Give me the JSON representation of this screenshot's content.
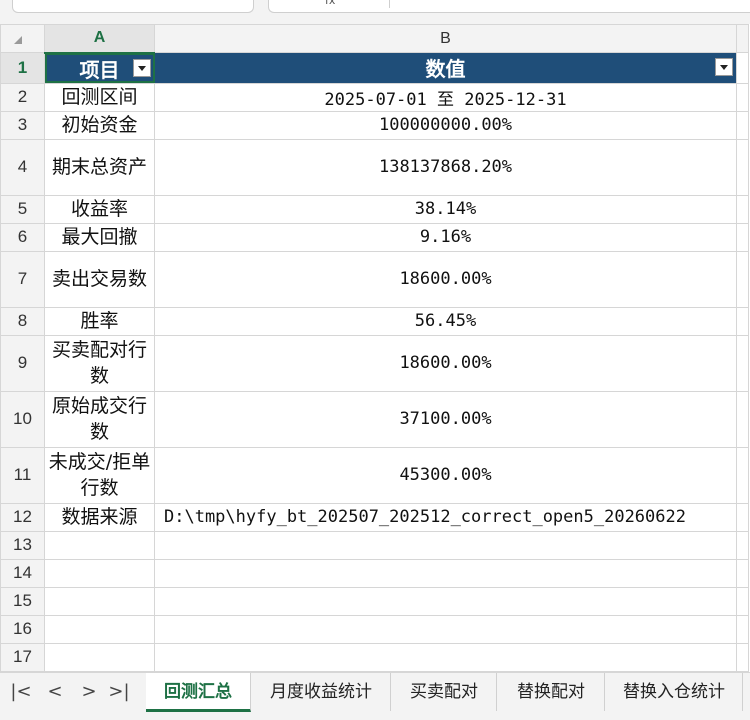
{
  "toolbar": {
    "formula_fx": "fx"
  },
  "columns": {
    "a": "A",
    "b": "B"
  },
  "header": {
    "a": "项目",
    "b": "数值"
  },
  "rows": [
    {
      "num": "2",
      "a": "回测区间",
      "b": "2025-07-01 至 2025-12-31"
    },
    {
      "num": "3",
      "a": "初始资金",
      "b": "100000000.00%"
    },
    {
      "num": "4",
      "a": "期末总资产",
      "b": "138137868.20%"
    },
    {
      "num": "5",
      "a": "收益率",
      "b": "38.14%"
    },
    {
      "num": "6",
      "a": "最大回撤",
      "b": "9.16%"
    },
    {
      "num": "7",
      "a": "卖出交易数",
      "b": "18600.00%"
    },
    {
      "num": "8",
      "a": "胜率",
      "b": "56.45%"
    },
    {
      "num": "9",
      "a": "买卖配对行数",
      "b": "18600.00%"
    },
    {
      "num": "10",
      "a": "原始成交行数",
      "b": "37100.00%"
    },
    {
      "num": "11",
      "a": "未成交/拒单行数",
      "b": "45300.00%"
    },
    {
      "num": "12",
      "a": "数据来源",
      "b": "D:\\tmp\\hyfy_bt_202507_202512_correct_open5_20260622"
    }
  ],
  "empty_rows": [
    "13",
    "14",
    "15",
    "16",
    "17"
  ],
  "header_row_num": "1",
  "nav": {
    "first": "|<",
    "prev": "<",
    "next": ">",
    "last": ">|"
  },
  "tabs": [
    "回测汇总",
    "月度收益统计",
    "买卖配对",
    "替换配对",
    "替换入仓统计"
  ],
  "active_tab": 0,
  "colors": {
    "header_bg": "#1f4e79",
    "accent": "#1e7145"
  }
}
